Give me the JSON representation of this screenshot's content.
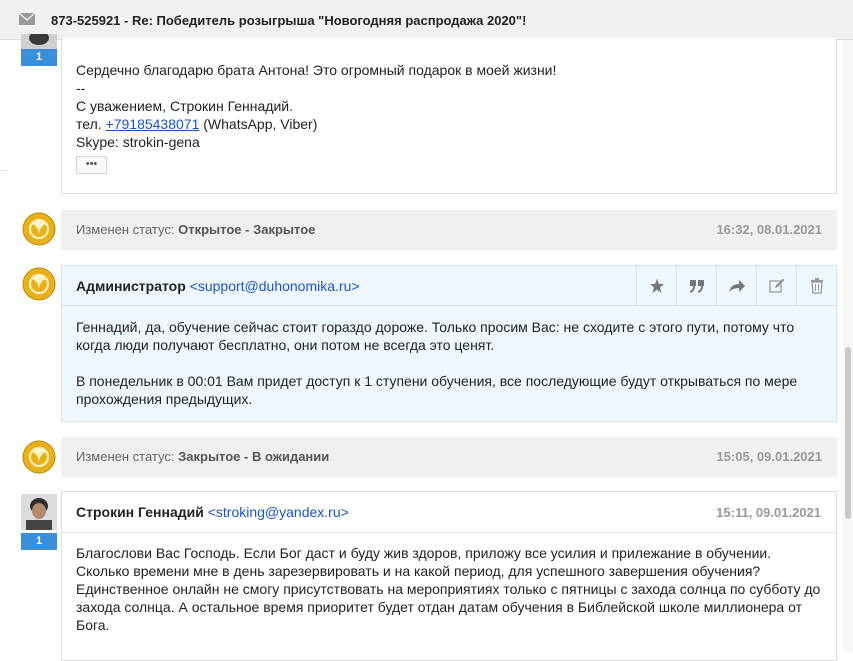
{
  "ticket": {
    "subject": "873-525921 - Re: Победитель розыгрыша \"Новогодняя распродажа 2020\"!"
  },
  "messages": [
    {
      "badge": "1",
      "lines": [
        "Сердечно благодарю брата Антона! Это огромный подарок в моей жизни!",
        "--",
        "С уважением, Строкин Геннадий."
      ],
      "phone_prefix": "тел. ",
      "phone": "+79185438071",
      "phone_suffix": " (WhatsApp, Viber)",
      "skype": "Skype: strokin-gena",
      "more_label": "•••"
    },
    {
      "author": "Администратор",
      "email": "<support@duhonomika.ru>",
      "paragraphs": [
        "Геннадий, да, обучение сейчас стоит гораздо дороже. Только просим Вас: не сходите с этого пути, потому что когда люди получают бесплатно, они потом не всегда это ценят.",
        "В понедельник в 00:01 Вам придет доступ к 1 ступени обучения, все последующие будут открываться по мере прохождения предыдущих."
      ]
    },
    {
      "author": "Строкин Геннадий",
      "email": "<stroking@yandex.ru>",
      "time": "15:11, 09.01.2021",
      "badge": "1",
      "text": "Благослови Вас Господь. Если Бог даст и буду жив здоров, приложу все усилия и прилежание в обучении. Сколько времени мне в день зарезервировать и на какой период, для успешного завершения обучения? Единственное онлайн не смогу присутствовать на мероприятиях только с пятницы с захода солнца по субботу до захода солнца. А остальное время приоритет будет отдан датам обучения в Библейской школе миллионера от Бога."
    }
  ],
  "status_changes": [
    {
      "label": "Изменен статус:",
      "value": "Открытое - Закрытое",
      "time": "16:32, 08.01.2021"
    },
    {
      "label": "Изменен статус:",
      "value": "Закрытое - В ожидании",
      "time": "15:05, 09.01.2021"
    }
  ],
  "toolbar_icons": [
    "star-icon",
    "quote-icon",
    "forward-icon",
    "edit-icon",
    "trash-icon"
  ],
  "colors": {
    "badge": "#3b8fd8",
    "link": "#1a55c4",
    "admin_bg": "#eff7fe",
    "logo": "#e8b019"
  }
}
